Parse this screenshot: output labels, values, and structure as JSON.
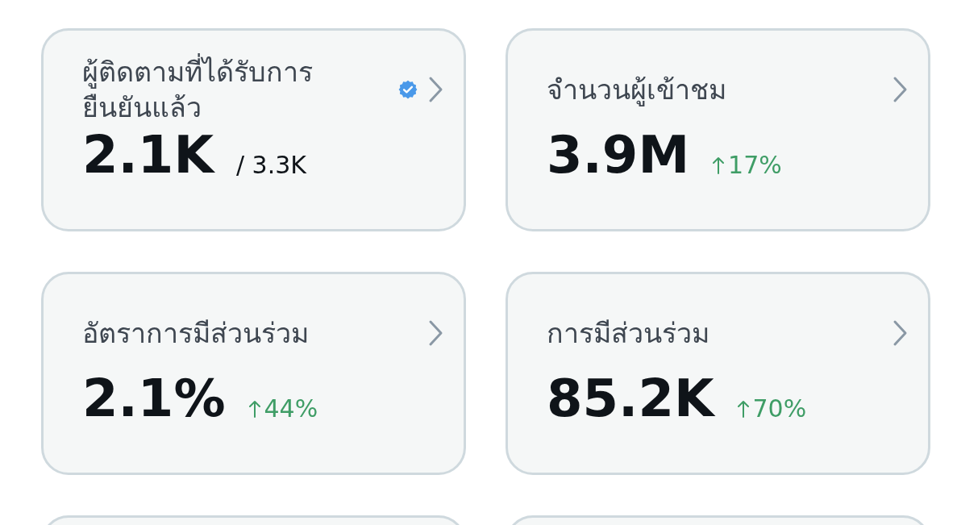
{
  "cards": [
    {
      "kind": "stat",
      "title": "ผู้ติดตามที่ได้รับการยืนยันแล้ว",
      "verified": true,
      "value": "2.1K",
      "total": "/ 3.3K"
    },
    {
      "kind": "stat",
      "title": "จำนวนผู้เข้าชม",
      "verified": false,
      "value": "3.9M",
      "rising": true,
      "change": "17%"
    },
    {
      "kind": "stat",
      "title": "อัตราการมีส่วนร่วม",
      "verified": false,
      "value": "2.1%",
      "rising": true,
      "change": "44%"
    },
    {
      "kind": "stat",
      "title": "การมีส่วนร่วม",
      "verified": false,
      "value": "85.2K",
      "rising": true,
      "change": "70%"
    },
    {
      "kind": "partial"
    },
    {
      "kind": "partial"
    }
  ]
}
